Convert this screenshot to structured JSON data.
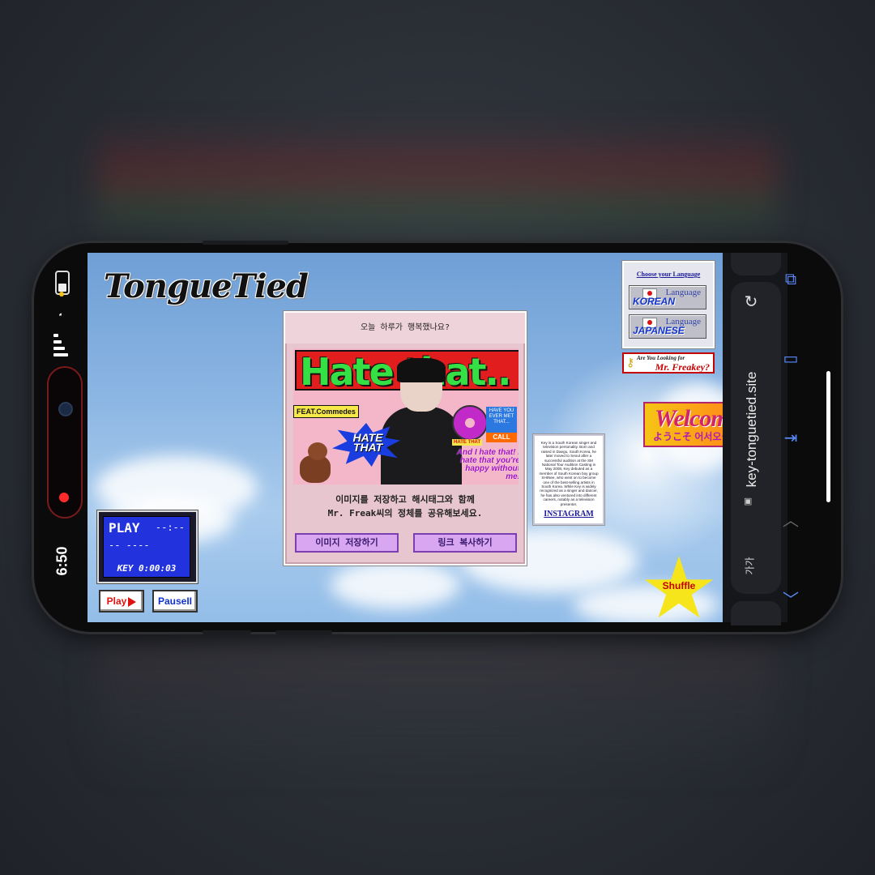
{
  "status": {
    "time": "6:50"
  },
  "site": {
    "logo": "TongueTied",
    "panel_prompt": "오늘 하루가 행복했나요?",
    "cover_title": "Hate that..",
    "feat": "FEAT.Commedes",
    "burst": "HATE THAT",
    "small_sticker": "HATE THAT",
    "question_sticker": "HAVE YOU EVER MET THAT...",
    "date_sticker": "CALL",
    "lyric": "And I hate that! I hate that you're happy without me!",
    "share_line1": "이미지를 저장하고 해시태그와 함께",
    "share_line2": "Mr. Freak씨의 정체를 공유해보세요.",
    "save_button": "이미지 저장하기",
    "copy_button": "링크 복사하기"
  },
  "language": {
    "title": "Choose your Language",
    "korean": "KOREAN",
    "japanese": "JAPANESE",
    "lang_word": "Language"
  },
  "freakey": {
    "line1": "Are You Looking for",
    "line2": "Mr. Freakey?"
  },
  "welcome": {
    "title": "Welcom",
    "sub": "ようこそ 어서오십시"
  },
  "bio": {
    "text": "Key is a South Korean singer and television personality. Born and raised in Daegu, South Korea, he later moved to Seoul after a successful audition at the SM National Tour Audition Casting in May 2008, Key debuted as a member of South Korean boy group SHINee, who went on to become one of the best-selling artists in South Korea. While Key is widely recognized as a singer and dancer, he has also ventured into different careers, notably as a television presenter.",
    "instagram": "INSTAGRAM"
  },
  "player": {
    "state": "PLAY",
    "time": "KEY 0:00:03",
    "play_button": "Play",
    "pause_button": "PauseII"
  },
  "shuffle": "Shuffle",
  "browser": {
    "url": "key-tonguetied.site",
    "aa": "가가"
  },
  "icons": [
    "battery-icon",
    "wifi-icon",
    "signal-icon",
    "camera-icon",
    "record-icon",
    "tabs-icon",
    "bookmarks-icon",
    "share-icon",
    "up-icon",
    "down-icon",
    "refresh-icon",
    "lock-icon",
    "key-icon",
    "star-icon"
  ]
}
